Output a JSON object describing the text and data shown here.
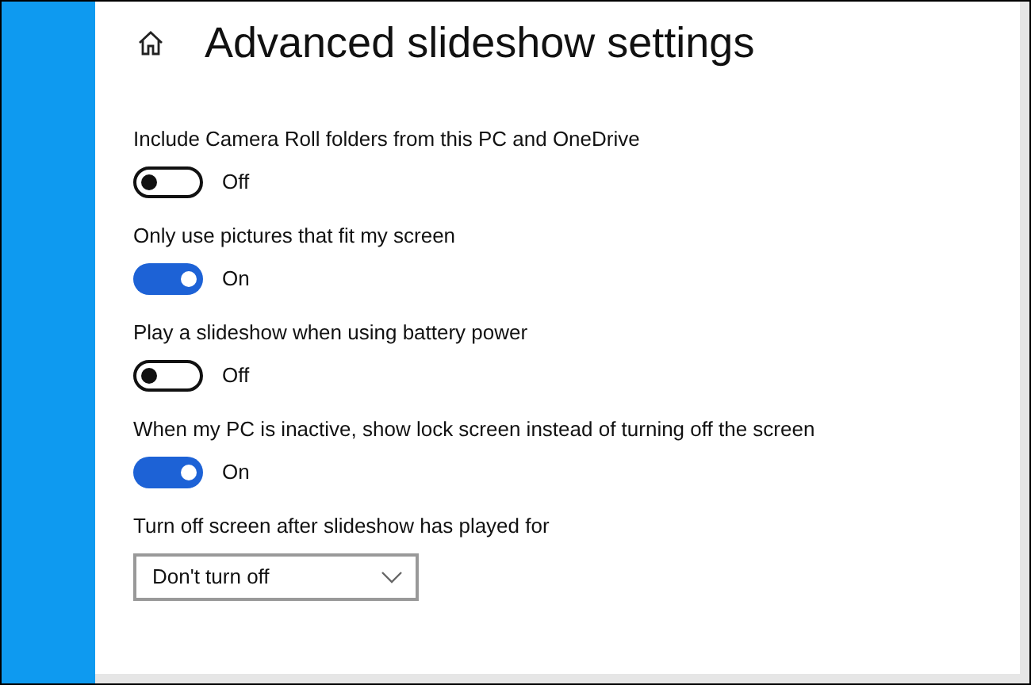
{
  "page": {
    "title": "Advanced slideshow settings"
  },
  "settings": [
    {
      "kind": "toggle",
      "label": "Include Camera Roll folders from this PC and OneDrive",
      "on": false,
      "state_label": "Off"
    },
    {
      "kind": "toggle",
      "label": "Only use pictures that fit my screen",
      "on": true,
      "state_label": "On"
    },
    {
      "kind": "toggle",
      "label": "Play a slideshow when using battery power",
      "on": false,
      "state_label": "Off"
    },
    {
      "kind": "toggle",
      "label": "When my PC is inactive, show lock screen instead of turning off the screen",
      "on": true,
      "state_label": "On"
    },
    {
      "kind": "dropdown",
      "label": "Turn off screen after slideshow has played for",
      "value": "Don't turn off"
    }
  ]
}
